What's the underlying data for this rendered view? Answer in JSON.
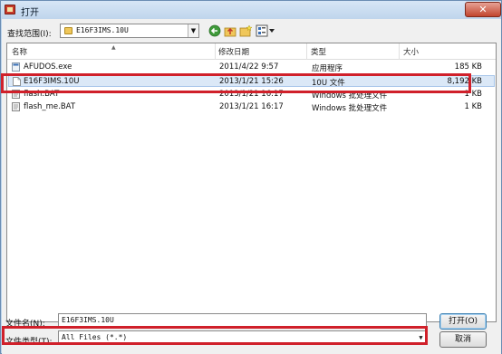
{
  "window": {
    "title": "打开",
    "close_glyph": "✕"
  },
  "toolbar": {
    "look_in_label": "查找范围(I):",
    "look_in_value": "E16F3IMS.10U",
    "dropdown_glyph": "▼"
  },
  "columns": {
    "name": "名称",
    "modified": "修改日期",
    "type": "类型",
    "size": "大小",
    "sort_glyph": "▲"
  },
  "files": [
    {
      "name": "AFUDOS.exe",
      "modified": "2011/4/22 9:57",
      "type": "应用程序",
      "size": "185 KB",
      "icon": "exe-icon"
    },
    {
      "name": "E16F3IMS.10U",
      "modified": "2013/1/21 15:26",
      "type": "10U 文件",
      "size": "8,192 KB",
      "icon": "file-icon"
    },
    {
      "name": "flash.BAT",
      "modified": "2013/1/21 16:17",
      "type": "Windows 批处理文件",
      "size": "1 KB",
      "icon": "bat-icon"
    },
    {
      "name": "flash_me.BAT",
      "modified": "2013/1/21 16:17",
      "type": "Windows 批处理文件",
      "size": "1 KB",
      "icon": "bat-icon"
    }
  ],
  "footer": {
    "file_name_label": "文件名(N):",
    "file_name_value": "E16F3IMS.10U",
    "file_type_label": "文件类型(T):",
    "file_type_value": "All Files (*.*)",
    "dropdown_glyph": "▼",
    "open_label": "打开(O)",
    "cancel_label": "取消"
  },
  "colors": {
    "highlight": "#d0202a",
    "selection": "#dbe8f7",
    "titlebar": "#bfd5ec"
  }
}
